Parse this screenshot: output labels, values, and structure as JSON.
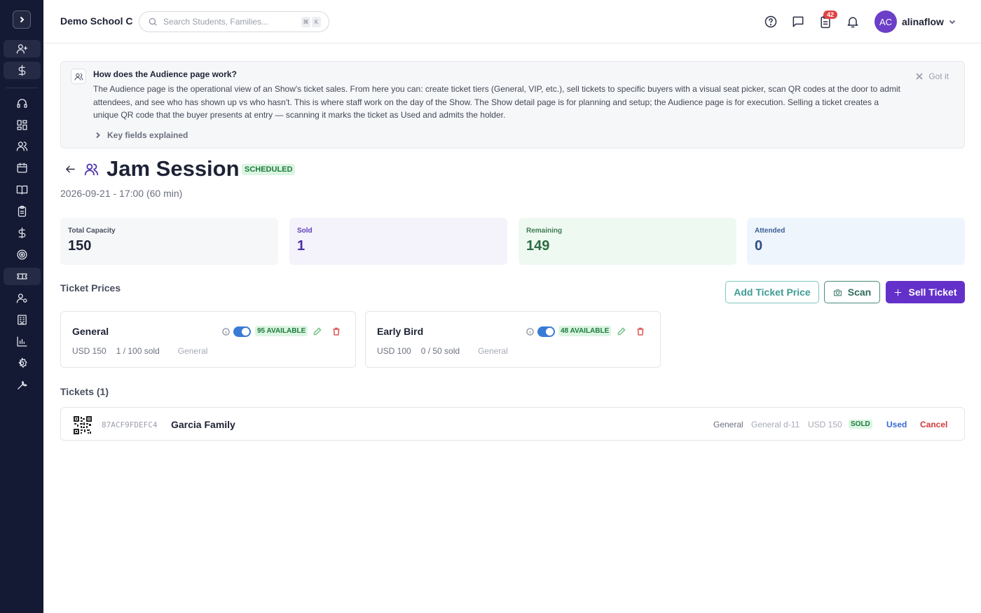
{
  "header": {
    "school_name": "Demo School C",
    "search_placeholder": "Search Students, Families...",
    "shortcut_keys": [
      "⌘",
      "K"
    ],
    "notification_count": "42",
    "avatar_initials": "AC",
    "username": "alinaflow"
  },
  "sidebar": {
    "items": [
      "add-user-icon",
      "dollar-icon",
      "headset-icon",
      "dashboard-icon",
      "users-icon",
      "calendar-icon",
      "book-icon",
      "clipboard-icon",
      "dollar-icon",
      "target-icon",
      "ticket-icon",
      "user-gear-icon",
      "building-icon",
      "chart-icon",
      "settings-icon",
      "wrench-icon"
    ],
    "active": "ticket-icon"
  },
  "help_panel": {
    "title": "How does the Audience page work?",
    "body": "The Audience page is the operational view of an Show's ticket sales. From here you can: create ticket tiers (General, VIP, etc.), sell tickets to specific buyers with a visual seat picker, scan QR codes at the door to admit attendees, and see who has shown up vs who hasn't. This is where staff work on the day of the Show. The Show detail page is for planning and setup; the Audience page is for execution. Selling a ticket creates a unique QR code that the buyer presents at entry — scanning it marks the ticket as Used and admits the holder.",
    "dismiss_label": "Got it",
    "key_fields_label": "Key fields explained"
  },
  "show": {
    "title": "Jam Session",
    "status": "SCHEDULED",
    "datetime": "2026-09-21 - 17:00 (60 min)"
  },
  "stats": [
    {
      "label": "Total Capacity",
      "value": "150",
      "bg": "#f6f7f9",
      "label_color": "#4a4f60",
      "value_color": "#1e2235"
    },
    {
      "label": "Sold",
      "value": "1",
      "bg": "#f4f2fa",
      "label_color": "#5b3fb8",
      "value_color": "#4b2fa8"
    },
    {
      "label": "Remaining",
      "value": "149",
      "bg": "#eefaf1",
      "label_color": "#3f7a52",
      "value_color": "#2f6b45"
    },
    {
      "label": "Attended",
      "value": "0",
      "bg": "#eef5fd",
      "label_color": "#3a5f95",
      "value_color": "#2c4f82"
    }
  ],
  "ticket_prices": {
    "section_title": "Ticket Prices",
    "add_label": "Add Ticket Price",
    "scan_label": "Scan",
    "sell_label": "Sell Ticket",
    "items": [
      {
        "name": "General",
        "available": "95 AVAILABLE",
        "price": "USD 150",
        "sold": "1 / 100 sold",
        "category": "General"
      },
      {
        "name": "Early Bird",
        "available": "48 AVAILABLE",
        "price": "USD 100",
        "sold": "0 / 50 sold",
        "category": "General"
      }
    ]
  },
  "tickets": {
    "section_title": "Tickets (1)",
    "rows": [
      {
        "code": "87ACF9FDEFC4",
        "buyer": "Garcia Family",
        "tier": "General",
        "seat": "General d-11",
        "price": "USD 150",
        "status": "SOLD",
        "used_label": "Used",
        "cancel_label": "Cancel"
      }
    ]
  }
}
